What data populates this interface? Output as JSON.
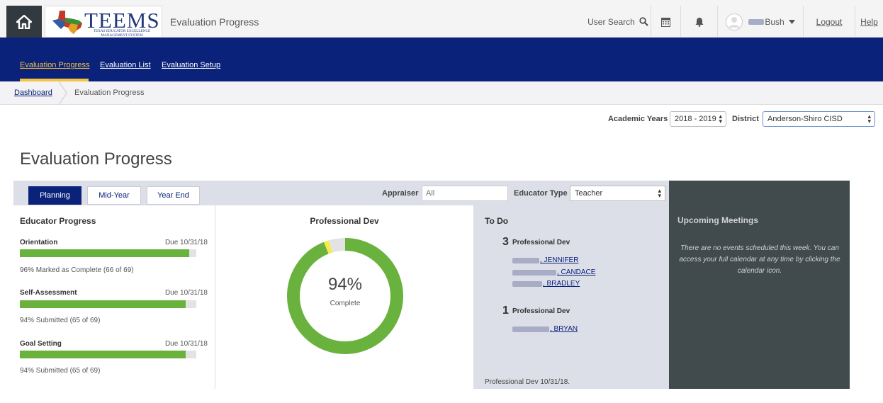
{
  "header": {
    "logo_text": "TEEMS",
    "logo_sub": "TEXAS EDUCATOR EXCELLENCE MANAGEMENT SYSTEM",
    "app_title": "Evaluation Progress",
    "user_search": "User Search",
    "user_name": "Bush",
    "logout": "Logout",
    "help": "Help"
  },
  "nav": {
    "items": [
      {
        "label": "Evaluation Progress",
        "active": true
      },
      {
        "label": "Evaluation List",
        "active": false
      },
      {
        "label": "Evaluation Setup",
        "active": false
      }
    ]
  },
  "breadcrumb": {
    "link": "Dashboard",
    "current": "Evaluation Progress"
  },
  "filters": {
    "years_label": "Academic Years",
    "years_value": "2018 - 2019",
    "district_label": "District",
    "district_value": "Anderson-Shiro CISD"
  },
  "page_title": "Evaluation Progress",
  "tabs": [
    {
      "label": "Planning",
      "active": true
    },
    {
      "label": "Mid-Year",
      "active": false
    },
    {
      "label": "Year End",
      "active": false
    }
  ],
  "appraiser": {
    "label": "Appraiser",
    "placeholder": "All"
  },
  "educator_type": {
    "label": "Educator Type",
    "value": "Teacher"
  },
  "educator_progress": {
    "title": "Educator Progress",
    "items": [
      {
        "label": "Orientation",
        "due": "Due 10/31/18",
        "progress": 0.96,
        "status": "96% Marked as Complete (66 of 69)"
      },
      {
        "label": "Self-Assessment",
        "due": "Due 10/31/18",
        "progress": 0.94,
        "status": "94% Submitted (65 of 69)"
      },
      {
        "label": "Goal Setting",
        "due": "Due 10/31/18",
        "progress": 0.94,
        "status": "94% Submitted (65 of 69)"
      }
    ]
  },
  "professional_dev": {
    "title": "Professional Dev",
    "percent_text": "94%",
    "sub_text": "Complete",
    "segments": [
      {
        "name": "complete",
        "value": 0.94,
        "color": "#6ab23e"
      },
      {
        "name": "partial",
        "value": 0.014,
        "color": "#f5ec4a"
      },
      {
        "name": "remaining",
        "value": 0.046,
        "color": "#e3e3e3"
      }
    ]
  },
  "todo": {
    "title": "To Do",
    "groups": [
      {
        "count": "3",
        "label": "Professional Dev",
        "names": [
          ", JENNIFER",
          ", CANDACE",
          ", BRADLEY"
        ]
      },
      {
        "count": "1",
        "label": "Professional Dev",
        "names": [
          ", BRYAN"
        ]
      }
    ],
    "footer": "Professional Dev 10/31/18."
  },
  "meetings": {
    "title": "Upcoming Meetings",
    "body": "There are no events scheduled this week. You can access your full calendar at any time by clicking the calendar icon."
  },
  "colors": {
    "navy": "#0a2279",
    "accent": "#f5c242",
    "progress": "#6ab23e",
    "dark_panel": "#414a4d"
  }
}
